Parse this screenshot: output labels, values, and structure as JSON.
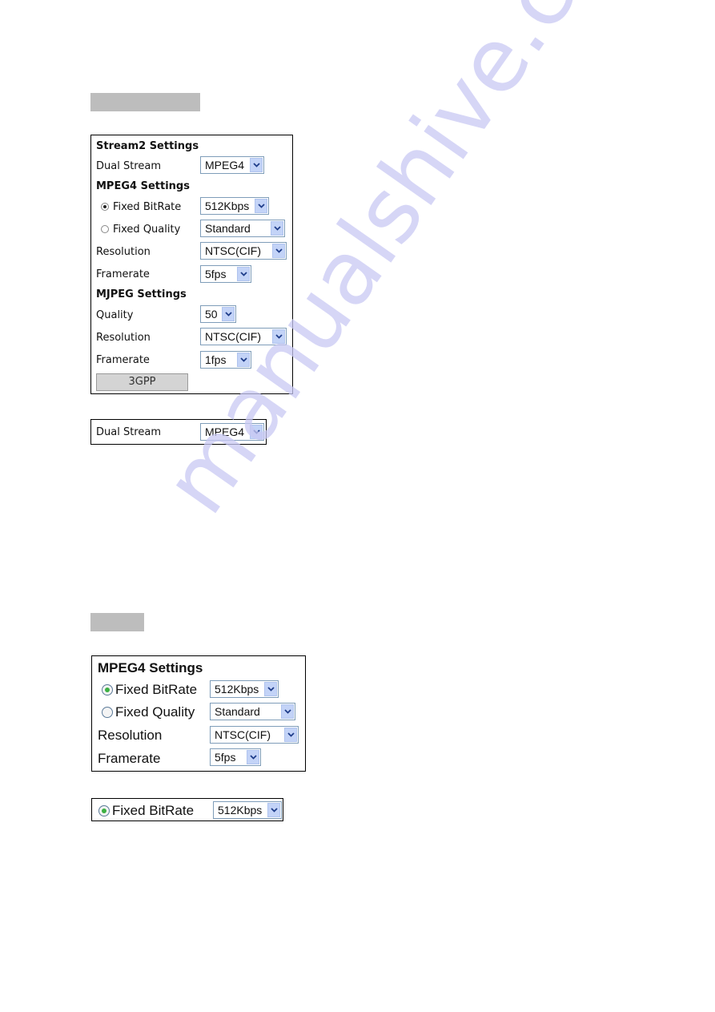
{
  "section1": {
    "panel": {
      "title": "Stream2 Settings",
      "dual_stream_label": "Dual Stream",
      "dual_stream_value": "MPEG4",
      "mpeg4_header": "MPEG4 Settings",
      "fixed_bitrate_label": "Fixed BitRate",
      "fixed_bitrate_value": "512Kbps",
      "fixed_bitrate_selected": true,
      "fixed_quality_label": "Fixed Quality",
      "fixed_quality_value": "Standard",
      "resolution_label": "Resolution",
      "resolution_value": "NTSC(CIF)",
      "framerate_label": "Framerate",
      "framerate_value": "5fps",
      "mjpeg_header": "MJPEG Settings",
      "mjpeg_quality_label": "Quality",
      "mjpeg_quality_value": "50",
      "mjpeg_resolution_label": "Resolution",
      "mjpeg_resolution_value": "NTSC(CIF)",
      "mjpeg_framerate_label": "Framerate",
      "mjpeg_framerate_value": "1fps",
      "button_3gpp": "3GPP"
    },
    "detail": {
      "dual_stream_label": "Dual Stream",
      "dual_stream_value": "MPEG4"
    }
  },
  "section2": {
    "panel": {
      "title": "MPEG4 Settings",
      "fixed_bitrate_label": "Fixed BitRate",
      "fixed_bitrate_value": "512Kbps",
      "fixed_quality_label": "Fixed Quality",
      "fixed_quality_value": "Standard",
      "resolution_label": "Resolution",
      "resolution_value": "NTSC(CIF)",
      "framerate_label": "Framerate",
      "framerate_value": "5fps"
    },
    "detail": {
      "fixed_bitrate_label": "Fixed BitRate",
      "fixed_bitrate_value": "512Kbps"
    }
  },
  "watermark": "manualshive.com",
  "colors": {
    "select_border": "#7f9db9",
    "arrow_bg": "#c3d3f7",
    "radio_green": "#3cb043",
    "gray_bar": "#bdbdbd"
  }
}
